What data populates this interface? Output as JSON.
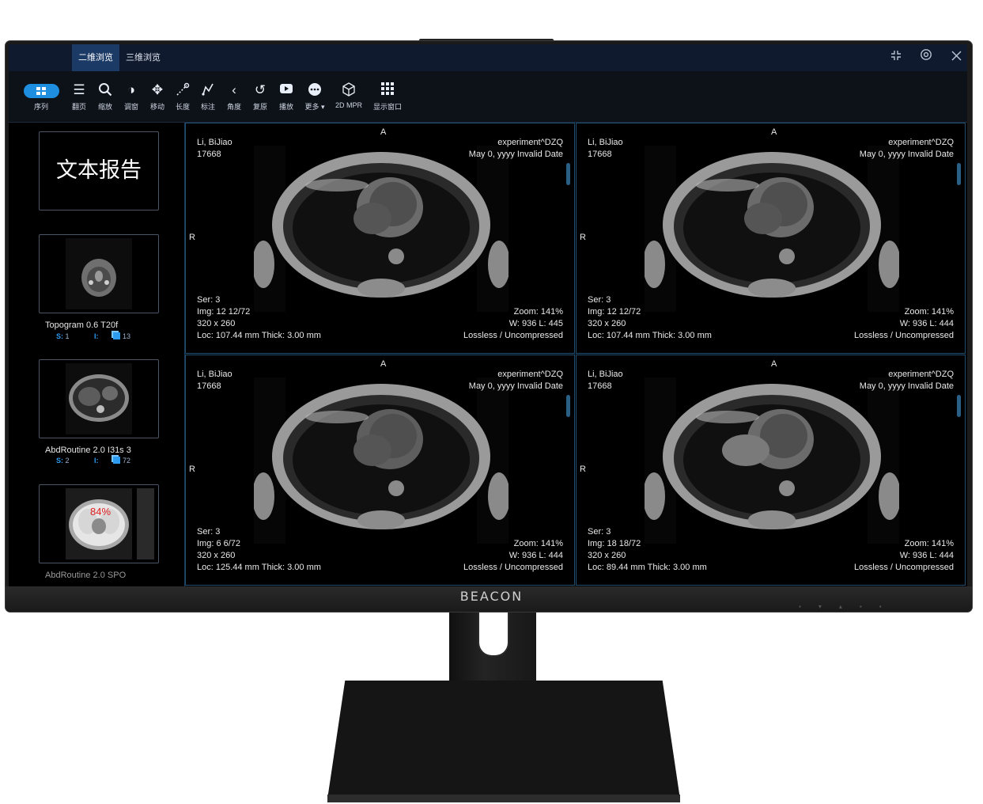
{
  "titlebar": {
    "tabs": [
      {
        "label": "二维浏览",
        "active": true
      },
      {
        "label": "三维浏览",
        "active": false
      }
    ],
    "buttons": {
      "collapse_icon": "collapse-icon",
      "settings_icon": "settings-icon",
      "close_icon": "close-icon"
    }
  },
  "toolbar": {
    "series_label": "序列",
    "tools": [
      {
        "name": "layout-page",
        "label": "翻页",
        "icon": "list-icon"
      },
      {
        "name": "zoom",
        "label": "缩放",
        "icon": "search-icon"
      },
      {
        "name": "window",
        "label": "调窗",
        "icon": "contrast-icon"
      },
      {
        "name": "move",
        "label": "移动",
        "icon": "move-icon"
      },
      {
        "name": "length",
        "label": "长度",
        "icon": "ruler-icon"
      },
      {
        "name": "annotate",
        "label": "标注",
        "icon": "annotate-icon"
      },
      {
        "name": "angle",
        "label": "角度",
        "icon": "angle-icon"
      },
      {
        "name": "reset",
        "label": "复原",
        "icon": "reset-icon"
      },
      {
        "name": "play",
        "label": "播放",
        "icon": "play-icon"
      },
      {
        "name": "more",
        "label": "更多 ▾",
        "icon": "more-icon"
      },
      {
        "name": "mpr",
        "label": "2D MPR",
        "icon": "cube-icon"
      },
      {
        "name": "layout",
        "label": "显示窗口",
        "icon": "grid-icon"
      }
    ]
  },
  "sidebar": {
    "report_label": "文本报告",
    "series": [
      {
        "name": "Topogram 0.6 T20f",
        "s_key": "S:",
        "s_val": "1",
        "i_key": "I:",
        "count": "13"
      },
      {
        "name": "AbdRoutine 2.0 I31s 3",
        "s_key": "S:",
        "s_val": "2",
        "i_key": "I:",
        "count": "72"
      },
      {
        "name": "AbdRoutine 2.0 SPO",
        "s_key": "",
        "s_val": "",
        "i_key": "",
        "count": ""
      }
    ],
    "overlay_percent": "84%"
  },
  "viewports": [
    {
      "orient_top": "A",
      "orient_left": "R",
      "patient": "Li, BiJiao",
      "id": "17668",
      "institution": "experiment^DZQ",
      "date": "May 0, yyyy Invalid Date",
      "series": "Ser: 3",
      "image": "Img: 12 12/72",
      "matrix": "320 x 260",
      "location": "Loc: 107.44 mm Thick: 3.00 mm",
      "zoom": "Zoom: 141%",
      "wl": "W: 936 L: 445",
      "compression": "Lossless / Uncompressed"
    },
    {
      "orient_top": "A",
      "orient_left": "R",
      "patient": "Li, BiJiao",
      "id": "17668",
      "institution": "experiment^DZQ",
      "date": "May 0, yyyy Invalid Date",
      "series": "Ser: 3",
      "image": "Img: 12 12/72",
      "matrix": "320 x 260",
      "location": "Loc: 107.44 mm Thick: 3.00 mm",
      "zoom": "Zoom: 141%",
      "wl": "W: 936 L: 444",
      "compression": "Lossless / Uncompressed"
    },
    {
      "orient_top": "A",
      "orient_left": "R",
      "patient": "Li, BiJiao",
      "id": "17668",
      "institution": "experiment^DZQ",
      "date": "May 0, yyyy Invalid Date",
      "series": "Ser: 3",
      "image": "Img: 6 6/72",
      "matrix": "320 x 260",
      "location": "Loc: 125.44 mm Thick: 3.00 mm",
      "zoom": "Zoom: 141%",
      "wl": "W: 936 L: 444",
      "compression": "Lossless / Uncompressed"
    },
    {
      "orient_top": "A",
      "orient_left": "R",
      "patient": "Li, BiJiao",
      "id": "17668",
      "institution": "experiment^DZQ",
      "date": "May 0, yyyy Invalid Date",
      "series": "Ser: 3",
      "image": "Img: 18 18/72",
      "matrix": "320 x 260",
      "location": "Loc: 89.44 mm Thick: 3.00 mm",
      "zoom": "Zoom: 141%",
      "wl": "W: 936 L: 444",
      "compression": "Lossless / Uncompressed"
    }
  ],
  "monitor": {
    "brand": "BEACON"
  }
}
